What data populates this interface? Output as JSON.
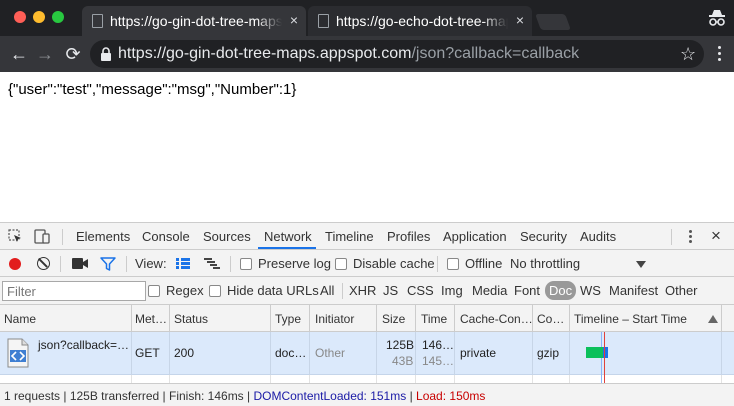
{
  "browser": {
    "tabs": [
      {
        "title": "https://go-gin-dot-tree-maps.appspot.com/json?callback=callback",
        "close_icon": "×"
      },
      {
        "title": "https://go-echo-dot-tree-maps.appspot.com/json?callback=callback",
        "close_icon": "×"
      }
    ],
    "url_host": "https://go-gin-dot-tree-maps.appspot.com",
    "url_path": "/json?callback=callback",
    "icons": {
      "back": "←",
      "forward": "→",
      "reload": "⟳",
      "star": "☆"
    }
  },
  "page": {
    "json_text": "{\"user\":\"test\",\"message\":\"msg\",\"Number\":1}"
  },
  "devtools": {
    "tabs": [
      "Elements",
      "Console",
      "Sources",
      "Network",
      "Timeline",
      "Profiles",
      "Application",
      "Security",
      "Audits"
    ],
    "active_tab": "Network",
    "close_icon": "×",
    "toolbar": {
      "view_label": "View:",
      "preserve_log": "Preserve log",
      "disable_cache": "Disable cache",
      "offline": "Offline",
      "throttling": "No throttling"
    },
    "filter": {
      "placeholder": "Filter",
      "regex": "Regex",
      "hide_data_urls": "Hide data URLs",
      "types": [
        "All",
        "XHR",
        "JS",
        "CSS",
        "Img",
        "Media",
        "Font",
        "Doc",
        "WS",
        "Manifest",
        "Other"
      ],
      "selected_type": "Doc"
    },
    "columns": [
      "Name",
      "Met…",
      "Status",
      "Type",
      "Initiator",
      "Size",
      "Time",
      "Cache-Con…",
      "Co…",
      "Timeline – Start Time"
    ],
    "rows": [
      {
        "name": "json?callback=…",
        "method": "GET",
        "status": "200",
        "type": "doc…",
        "initiator": "Other",
        "size": "125B",
        "size_content": "43B",
        "time": "146…",
        "latency": "145…",
        "cache_control": "private",
        "content_encoding": "gzip"
      }
    ],
    "status_bar": {
      "summary": "1 requests | 125B transferred | Finish: 146ms | ",
      "dom_content_loaded": "DOMContentLoaded: 151ms",
      "separator": " | ",
      "load": "Load: 150ms"
    }
  },
  "colors": {
    "chrome_dark": "#202124",
    "tab_active": "#35363a",
    "selected_row": "#dbe9fb",
    "record": "#e21d1d",
    "timeline_green": "#0bc05b",
    "timeline_blue": "#1a73e8"
  }
}
